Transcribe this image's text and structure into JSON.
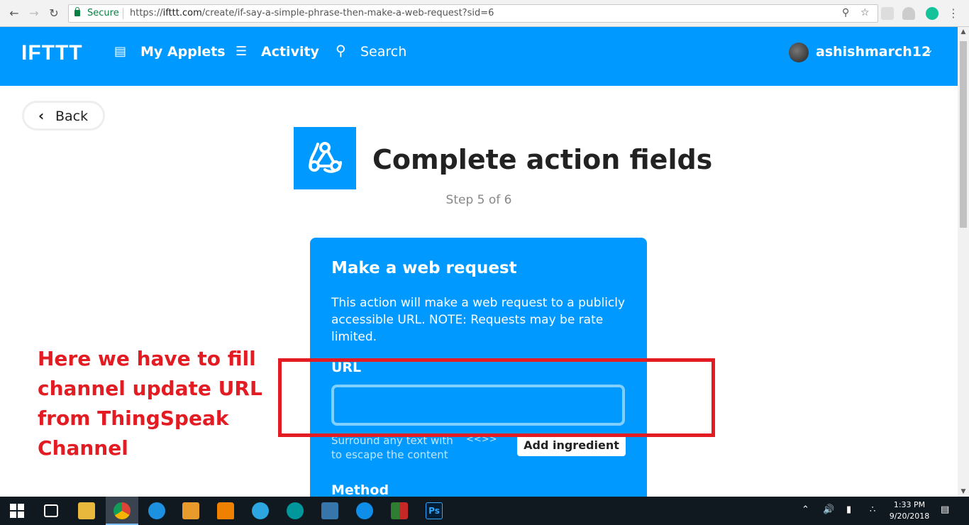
{
  "browser": {
    "secure_label": "Secure",
    "url_scheme": "https://",
    "url_host": "ifttt.com",
    "url_path": "/create/if-say-a-simple-phrase-then-make-a-web-request?sid=6"
  },
  "header": {
    "logo": "IFTTT",
    "my_applets": "My Applets",
    "activity": "Activity",
    "search": "Search",
    "username": "ashishmarch12"
  },
  "page": {
    "back_label": "Back",
    "title": "Complete action fields",
    "step": "Step 5 of 6"
  },
  "action_card": {
    "title": "Make a web request",
    "description": "This action will make a web request to a publicly accessible URL. NOTE: Requests may be rate limited.",
    "url_label": "URL",
    "url_value": "",
    "helper_text": "Surround any text with",
    "helper_text_2": "to escape the content",
    "helper_tag": "<<>>",
    "add_ingredient": "Add ingredient",
    "method_label": "Method"
  },
  "annotation": {
    "text": "Here we have to fill channel update URL from ThingSpeak Channel",
    "color": "#e31c23"
  },
  "taskbar": {
    "time": "1:33 PM",
    "date": "9/20/2018"
  },
  "colors": {
    "brand": "#0099ff",
    "annotation": "#e31c23"
  }
}
